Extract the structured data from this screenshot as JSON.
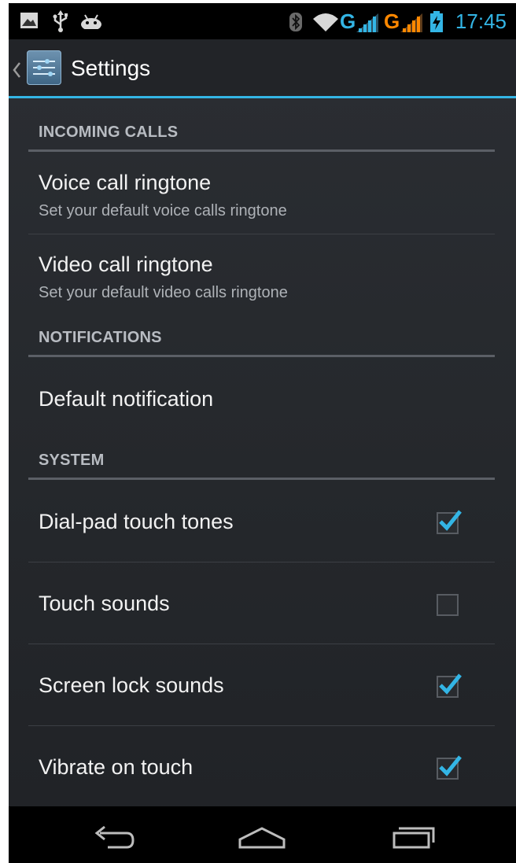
{
  "status_bar": {
    "time": "17:45",
    "network_1": "G",
    "network_2": "G",
    "icons": [
      "gallery-notification-icon",
      "usb-icon",
      "android-debug-icon",
      "bluetooth-icon",
      "wifi-icon",
      "signal-icon",
      "signal-icon",
      "battery-charging-icon"
    ]
  },
  "action_bar": {
    "title": "Settings",
    "app_icon": "settings-sliders-icon"
  },
  "sections": {
    "incoming_calls": {
      "header": "INCOMING CALLS",
      "items": [
        {
          "title": "Voice call ringtone",
          "summary": "Set your default voice calls ringtone"
        },
        {
          "title": "Video call ringtone",
          "summary": "Set your default video calls ringtone"
        }
      ]
    },
    "notifications": {
      "header": "NOTIFICATIONS",
      "items": [
        {
          "title": "Default notification"
        }
      ]
    },
    "system": {
      "header": "SYSTEM",
      "items": [
        {
          "title": "Dial-pad touch tones",
          "checked": true
        },
        {
          "title": "Touch sounds",
          "checked": false
        },
        {
          "title": "Screen lock sounds",
          "checked": true
        },
        {
          "title": "Vibrate on touch",
          "checked": true
        }
      ]
    }
  },
  "nav_bar": {
    "buttons": [
      "back-icon",
      "home-icon",
      "recent-apps-icon"
    ]
  },
  "colors": {
    "accent": "#33b5e5",
    "background": "#25282c",
    "status_bar": "#000000",
    "warning_signal": "#ff8800"
  }
}
